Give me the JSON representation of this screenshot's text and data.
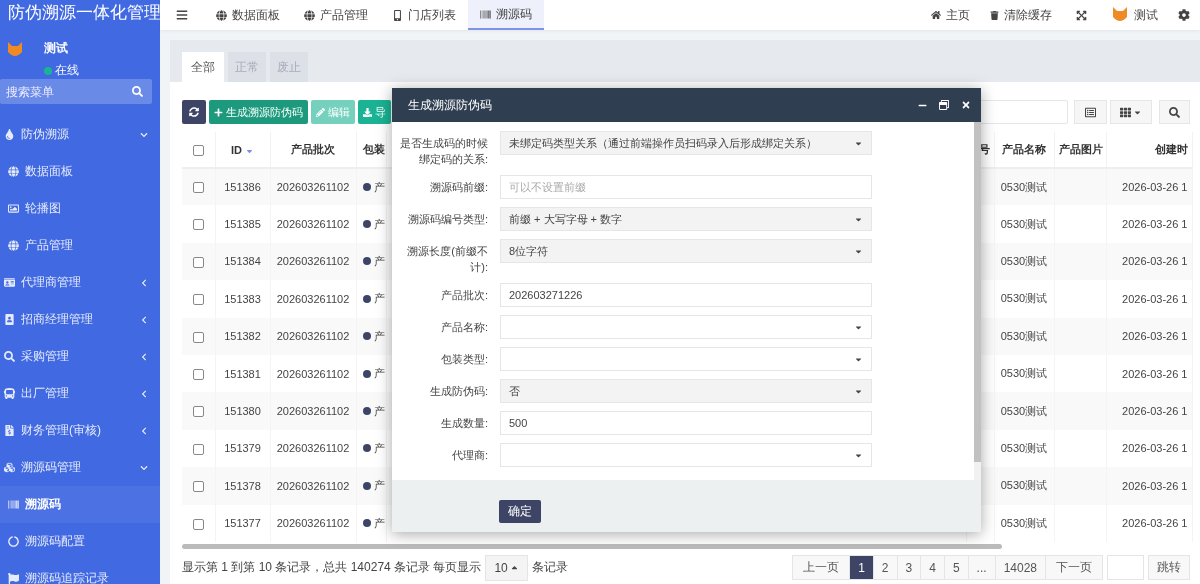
{
  "sidebar": {
    "title": "防伪溯源一体化管理",
    "user": {
      "name": "测试",
      "status": "在线",
      "online": true
    },
    "search": {
      "placeholder": "搜索菜单"
    },
    "menu": [
      {
        "label": "防伪溯源",
        "expanded": true,
        "children": [
          {
            "label": "数据面板",
            "selected": false
          },
          {
            "label": "轮播图",
            "selected": false
          },
          {
            "label": "产品管理",
            "selected": false
          }
        ]
      },
      {
        "label": "代理商管理",
        "expanded": false
      },
      {
        "label": "招商经理管理",
        "expanded": false
      },
      {
        "label": "采购管理",
        "expanded": false
      },
      {
        "label": "出厂管理",
        "expanded": false
      },
      {
        "label": "财务管理(审核)",
        "expanded": false
      },
      {
        "label": "溯源码管理",
        "expanded": true,
        "children": [
          {
            "label": "溯源码",
            "selected": true
          },
          {
            "label": "溯源码配置",
            "selected": false
          },
          {
            "label": "溯源码追踪记录",
            "selected": false
          }
        ]
      }
    ]
  },
  "top_nav": {
    "tabs": [
      {
        "label": "数据面板",
        "selected": false
      },
      {
        "label": "产品管理",
        "selected": false
      },
      {
        "label": "门店列表",
        "selected": false
      },
      {
        "label": "溯源码",
        "selected": true
      }
    ],
    "links": [
      "主页",
      "清除缓存"
    ],
    "user": "测试"
  },
  "filter_tabs": [
    {
      "label": "全部",
      "selected": true
    },
    {
      "label": "正常",
      "selected": false
    },
    {
      "label": "废止",
      "selected": false
    }
  ],
  "toolbar": {
    "buttons": [
      {
        "label": "生成溯源防伪码",
        "disabled": false
      },
      {
        "label": "编辑",
        "disabled": true
      },
      {
        "label": "导",
        "disabled": false
      }
    ]
  },
  "table": {
    "header_checked": false,
    "sort_descending": true,
    "columns": [
      "ID",
      "产品批次",
      "包装",
      "号",
      "产品名称",
      "产品图片",
      "创建时"
    ],
    "rows": [
      {
        "checked": false,
        "id": "151386",
        "batch": "202603261102",
        "package": "产",
        "product": "0530测试",
        "created": "2026-03-26 1"
      },
      {
        "checked": false,
        "id": "151385",
        "batch": "202603261102",
        "package": "产",
        "product": "0530测试",
        "created": "2026-03-26 1"
      },
      {
        "checked": false,
        "id": "151384",
        "batch": "202603261102",
        "package": "产",
        "product": "0530测试",
        "created": "2026-03-26 1"
      },
      {
        "checked": false,
        "id": "151383",
        "batch": "202603261102",
        "package": "产",
        "product": "0530测试",
        "created": "2026-03-26 1"
      },
      {
        "checked": false,
        "id": "151382",
        "batch": "202603261102",
        "package": "产",
        "product": "0530测试",
        "created": "2026-03-26 1"
      },
      {
        "checked": false,
        "id": "151381",
        "batch": "202603261102",
        "package": "产",
        "product": "0530测试",
        "created": "2026-03-26 1"
      },
      {
        "checked": false,
        "id": "151380",
        "batch": "202603261102",
        "package": "产",
        "product": "0530测试",
        "created": "2026-03-26 1"
      },
      {
        "checked": false,
        "id": "151379",
        "batch": "202603261102",
        "package": "产",
        "product": "0530测试",
        "created": "2026-03-26 1"
      },
      {
        "checked": false,
        "id": "151378",
        "batch": "202603261102",
        "package": "产",
        "product": "0530测试",
        "created": "2026-03-26 1"
      },
      {
        "checked": false,
        "id": "151377",
        "batch": "202603261102",
        "package": "产",
        "product": "0530测试",
        "created": "2026-03-26 1"
      }
    ]
  },
  "footer": {
    "summary": "显示第 1 到第 10 条记录，总共 140274 条记录 每页显示",
    "page_size": "10",
    "summary_after": "条记录"
  },
  "pagination": {
    "prev": "上一页",
    "pages": [
      {
        "label": "1",
        "selected": true
      },
      {
        "label": "2",
        "selected": false
      },
      {
        "label": "3",
        "selected": false
      },
      {
        "label": "4",
        "selected": false
      },
      {
        "label": "5",
        "selected": false
      },
      {
        "label": "...",
        "selected": false
      },
      {
        "label": "14028",
        "selected": false
      }
    ],
    "next": "下一页",
    "jump": "跳转"
  },
  "modal": {
    "title": "生成溯源防伪码",
    "fields": [
      {
        "kind": "select",
        "label": "是否生成码的时候绑定码的关系:",
        "value": "未绑定码类型关系（通过前端操作员扫码录入后形成绑定关系）",
        "disabled": true
      },
      {
        "kind": "input",
        "label": "溯源码前缀:",
        "placeholder": "可以不设置前缀"
      },
      {
        "kind": "select",
        "label": "溯源码编号类型:",
        "value": "前缀 + 大写字母 + 数字",
        "disabled": true
      },
      {
        "kind": "select",
        "label": "溯源长度(前缀不计):",
        "value": "8位字符",
        "disabled": true
      },
      {
        "kind": "input",
        "label": "产品批次:",
        "value": "202603271226"
      },
      {
        "kind": "select",
        "label": "产品名称:",
        "disabled": false
      },
      {
        "kind": "select",
        "label": "包装类型:",
        "disabled": false
      },
      {
        "kind": "select",
        "label": "生成防伪码:",
        "value": "否",
        "disabled": true
      },
      {
        "kind": "input",
        "label": "生成数量:",
        "value": "500"
      },
      {
        "kind": "select",
        "label": "代理商:",
        "disabled": false
      }
    ],
    "submit": "确定"
  }
}
